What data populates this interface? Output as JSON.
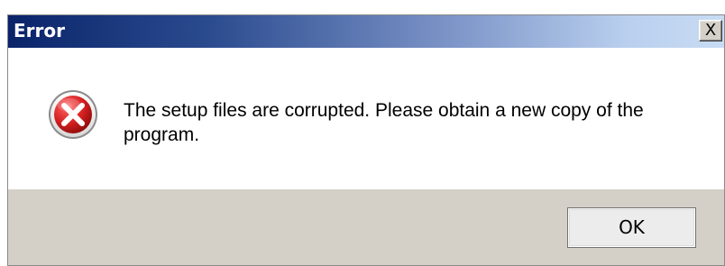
{
  "window": {
    "title": "Error",
    "close_label": "X"
  },
  "message": {
    "text": "The setup files are corrupted. Please obtain a new copy of the program.",
    "icon": "error-icon"
  },
  "buttons": {
    "ok_label": "OK"
  },
  "colors": {
    "titlebar_start": "#0a246a",
    "titlebar_end": "#c9dcf4",
    "button_strip": "#d4d0c8",
    "error_red": "#c4161c"
  }
}
